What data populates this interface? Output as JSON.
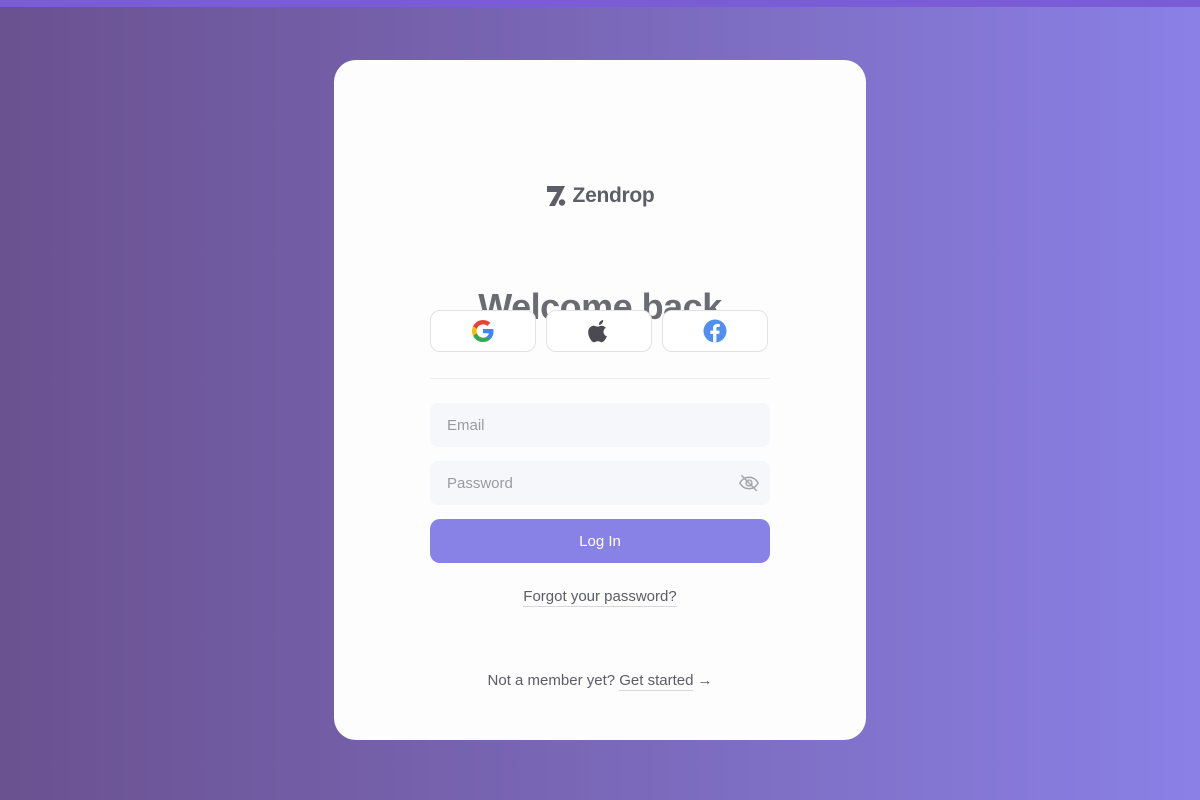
{
  "brand": {
    "name": "Zendrop",
    "logo_icon": "zendrop-logo-icon"
  },
  "heading": {
    "title": "Welcome back"
  },
  "social_login": {
    "buttons": [
      {
        "icon": "google-icon"
      },
      {
        "icon": "apple-icon"
      },
      {
        "icon": "facebook-icon"
      }
    ]
  },
  "form": {
    "email_placeholder": "Email",
    "email_value": "",
    "password_placeholder": "Password",
    "password_value": "",
    "password_toggle_icon": "eye-off-icon",
    "login_label": "Log In",
    "forgot_label": "Forgot your password?"
  },
  "signup": {
    "prompt": "Not a member yet?",
    "link_label": "Get started",
    "arrow": "→"
  },
  "colors": {
    "accent": "#8881e6",
    "top_bar": "#7a5cd6",
    "background_start": "#6a5190",
    "background_end": "#8a80e6",
    "facebook_blue": "#4f8ff0"
  }
}
